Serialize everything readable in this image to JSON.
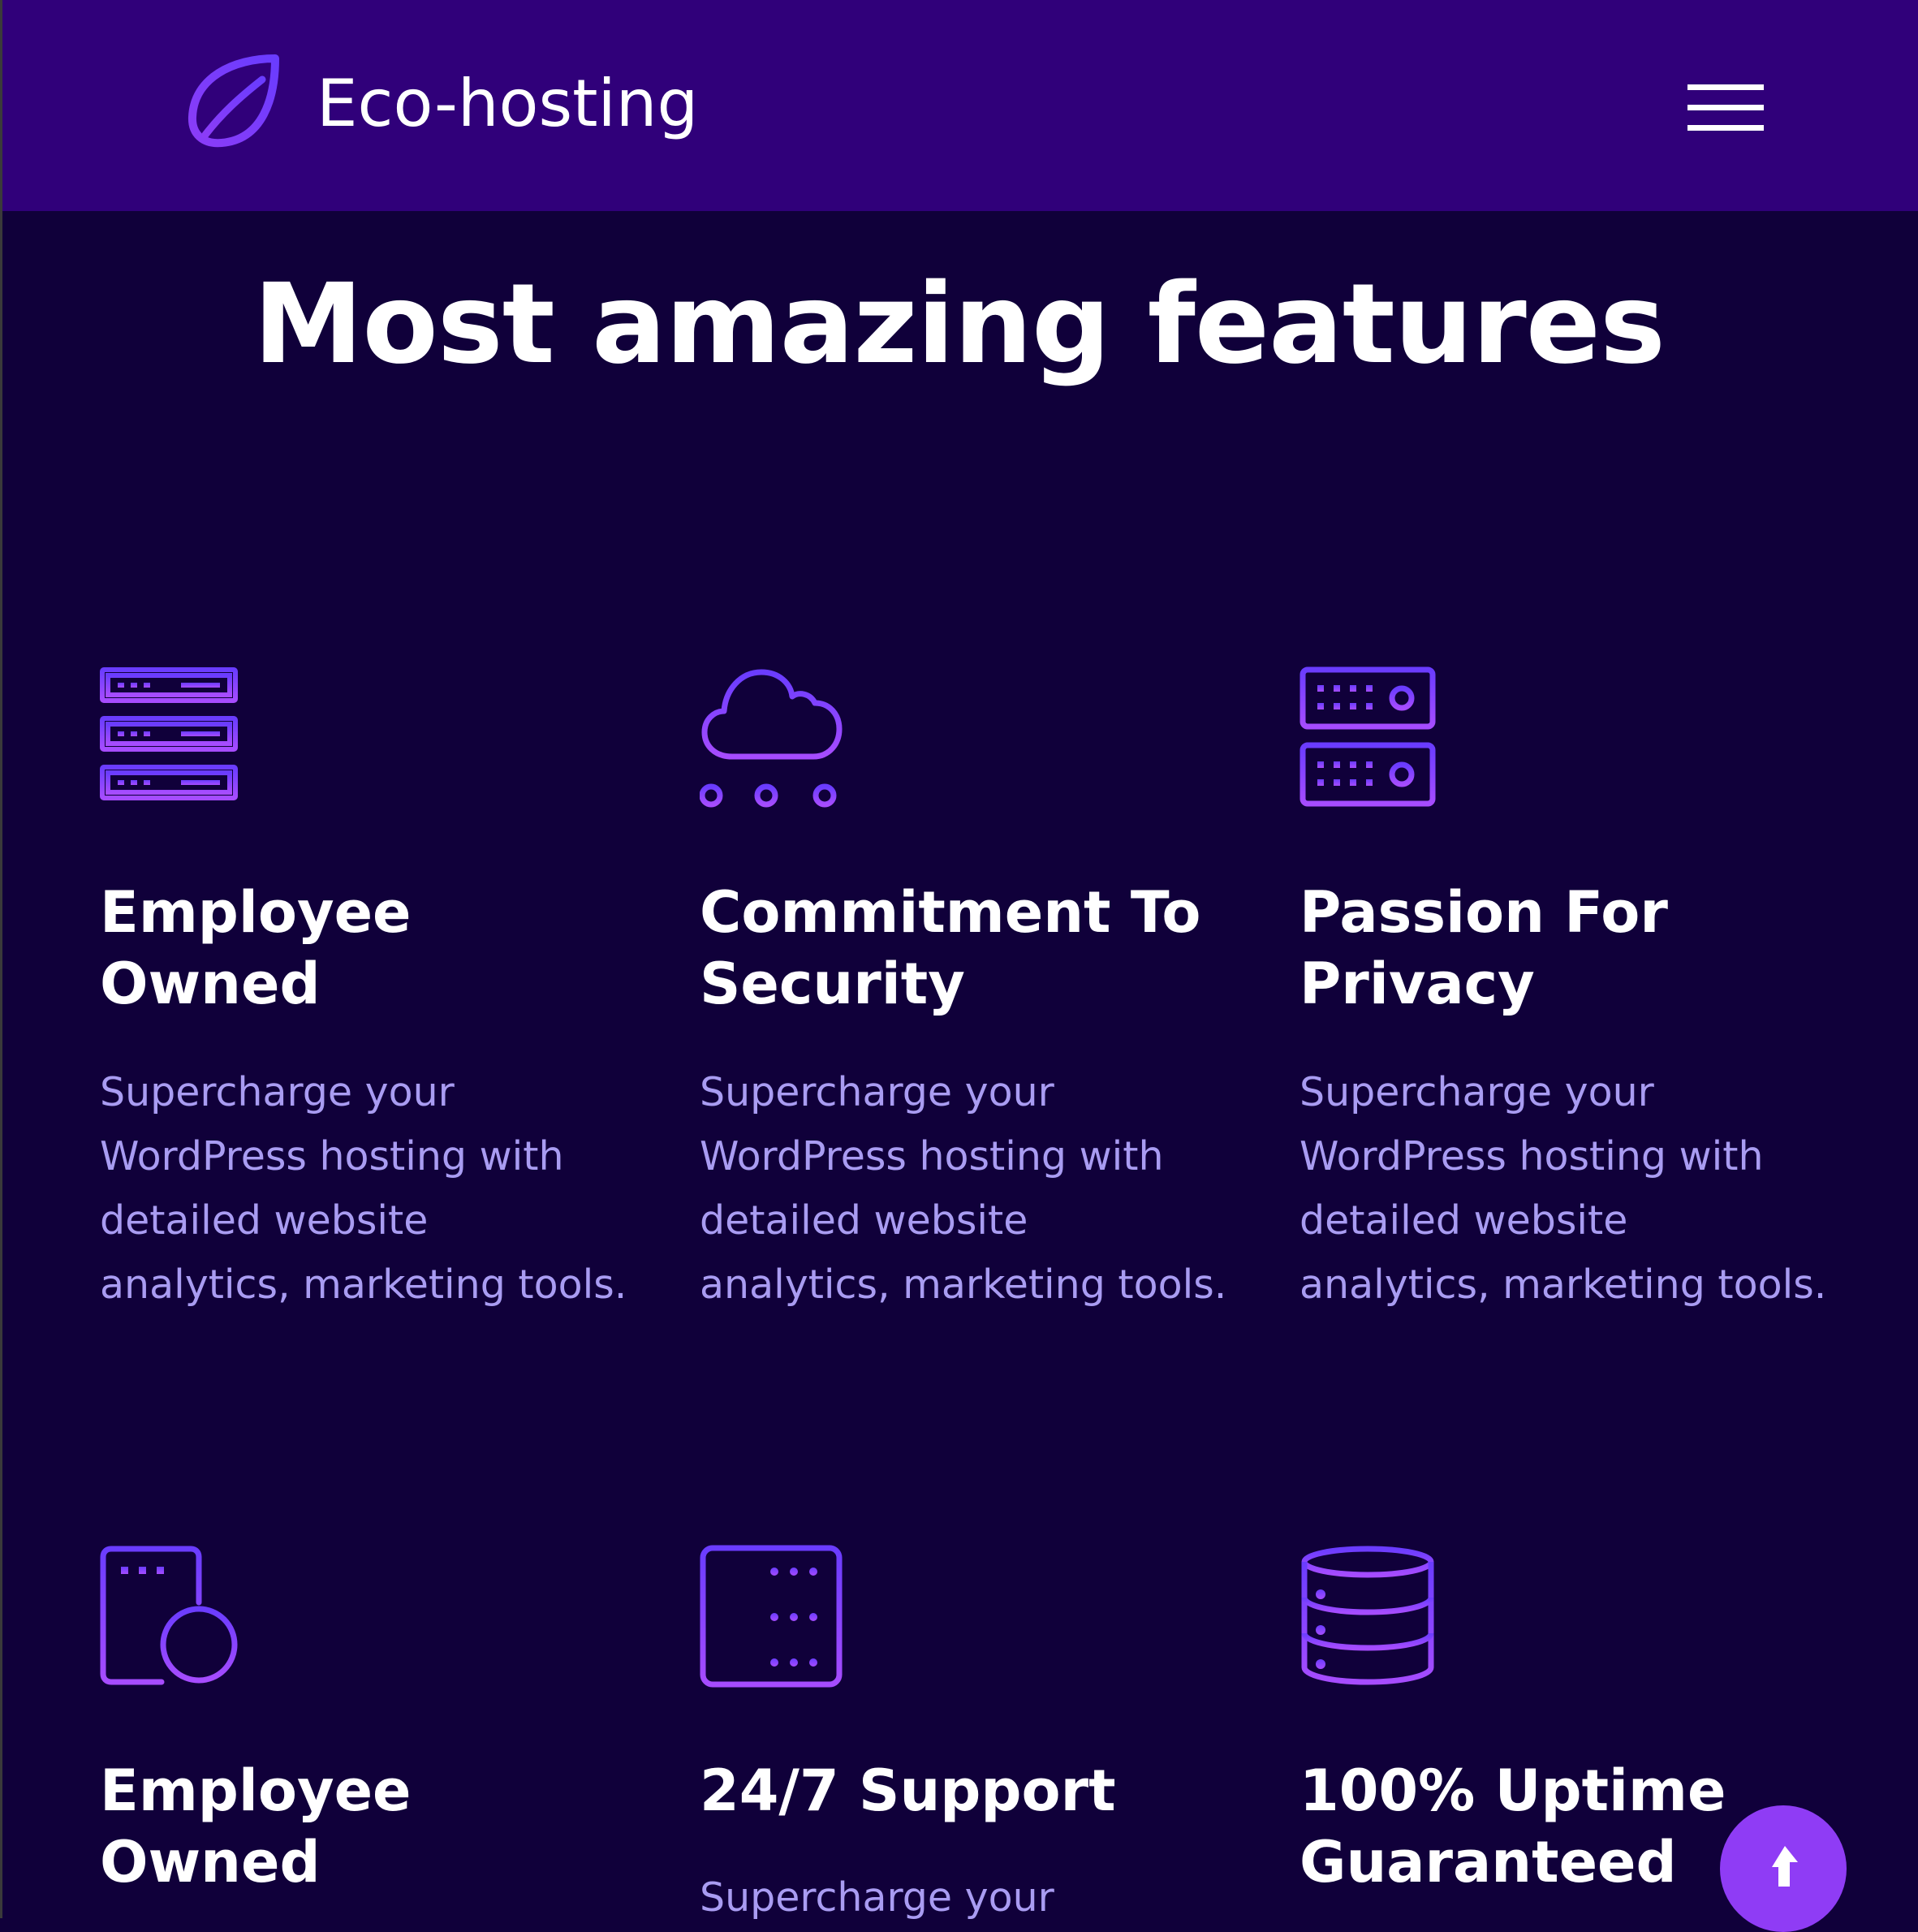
{
  "header": {
    "brand_name": "Eco-hosting",
    "logo_icon": "leaf-icon",
    "menu_icon": "hamburger-menu-icon",
    "background": "#30007a"
  },
  "main": {
    "heading": "Most amazing features",
    "background": "#10003a",
    "features": [
      {
        "icon": "server-rack-icon",
        "title": "Employee Owned",
        "description": "Supercharge your WordPress hosting with detailed website analytics, marketing tools."
      },
      {
        "icon": "cloud-network-icon",
        "title": "Commitment To Security",
        "description": "Supercharge your WordPress hosting with detailed website analytics, marketing tools."
      },
      {
        "icon": "server-drives-icon",
        "title": "Passion For Privacy",
        "description": "Supercharge your WordPress hosting with detailed website analytics, marketing tools."
      },
      {
        "icon": "server-remove-icon",
        "title": "Employee Owned",
        "description": ""
      },
      {
        "icon": "server-stack-icon",
        "title": "24/7 Support",
        "description": "Supercharge your"
      },
      {
        "icon": "database-icon",
        "title": "100% Uptime Guaranteed",
        "description": ""
      }
    ]
  },
  "scroll_top": {
    "icon": "arrow-up-icon",
    "color": "#8f3cf5"
  },
  "colors": {
    "accent": "#8f3cf5",
    "icon_gradient_start": "#6a3cff",
    "icon_gradient_end": "#a64cff",
    "description_text": "#a99cf2"
  }
}
